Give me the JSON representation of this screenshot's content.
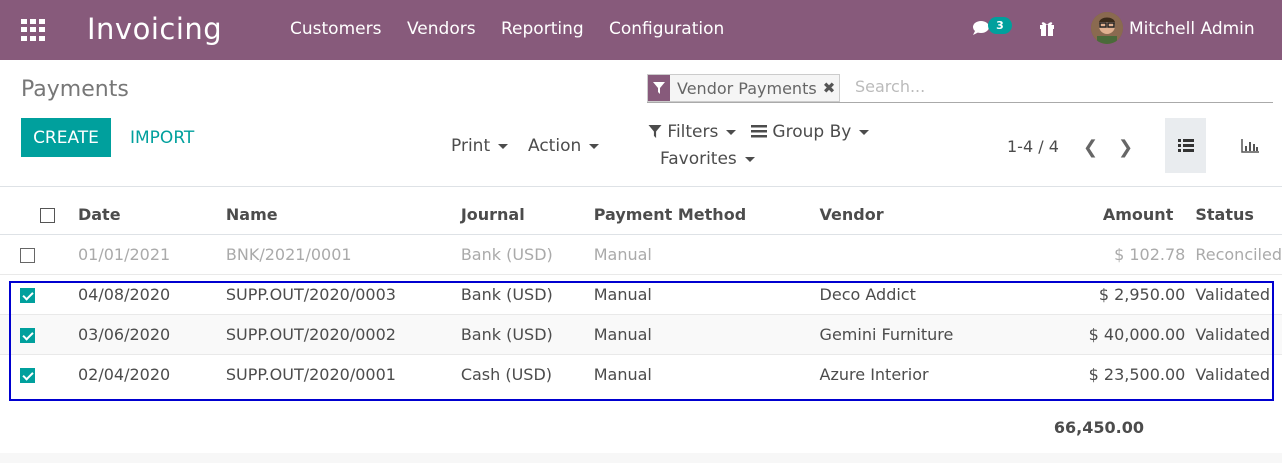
{
  "navbar": {
    "app_title": "Invoicing",
    "menu": [
      "Customers",
      "Vendors",
      "Reporting",
      "Configuration"
    ],
    "chat_count": "3",
    "user": "Mitchell Admin",
    "brand_color": "#875a7b"
  },
  "control_panel": {
    "breadcrumb": "Payments",
    "create_label": "CREATE",
    "import_label": "IMPORT",
    "print_label": "Print",
    "action_label": "Action",
    "filters_label": "Filters",
    "group_by_label": "Group By",
    "favorites_label": "Favorites",
    "facet_label": "Vendor Payments",
    "search_placeholder": "Search...",
    "pager": "1-4 / 4",
    "accent_color": "#00a09d"
  },
  "table": {
    "headers": [
      "Date",
      "Name",
      "Journal",
      "Payment Method",
      "Vendor",
      "Amount",
      "Status"
    ],
    "rows": [
      {
        "selected": false,
        "date": "01/01/2021",
        "name": "BNK/2021/0001",
        "journal": "Bank (USD)",
        "method": "Manual",
        "vendor": "",
        "amount": "$ 102.78",
        "status": "Reconciled"
      },
      {
        "selected": true,
        "date": "04/08/2020",
        "name": "SUPP.OUT/2020/0003",
        "journal": "Bank (USD)",
        "method": "Manual",
        "vendor": "Deco Addict",
        "amount": "$ 2,950.00",
        "status": "Validated"
      },
      {
        "selected": true,
        "date": "03/06/2020",
        "name": "SUPP.OUT/2020/0002",
        "journal": "Bank (USD)",
        "method": "Manual",
        "vendor": "Gemini Furniture",
        "amount": "$ 40,000.00",
        "status": "Validated"
      },
      {
        "selected": true,
        "date": "02/04/2020",
        "name": "SUPP.OUT/2020/0001",
        "journal": "Cash (USD)",
        "method": "Manual",
        "vendor": "Azure Interior",
        "amount": "$ 23,500.00",
        "status": "Validated"
      }
    ],
    "total": "66,450.00"
  }
}
